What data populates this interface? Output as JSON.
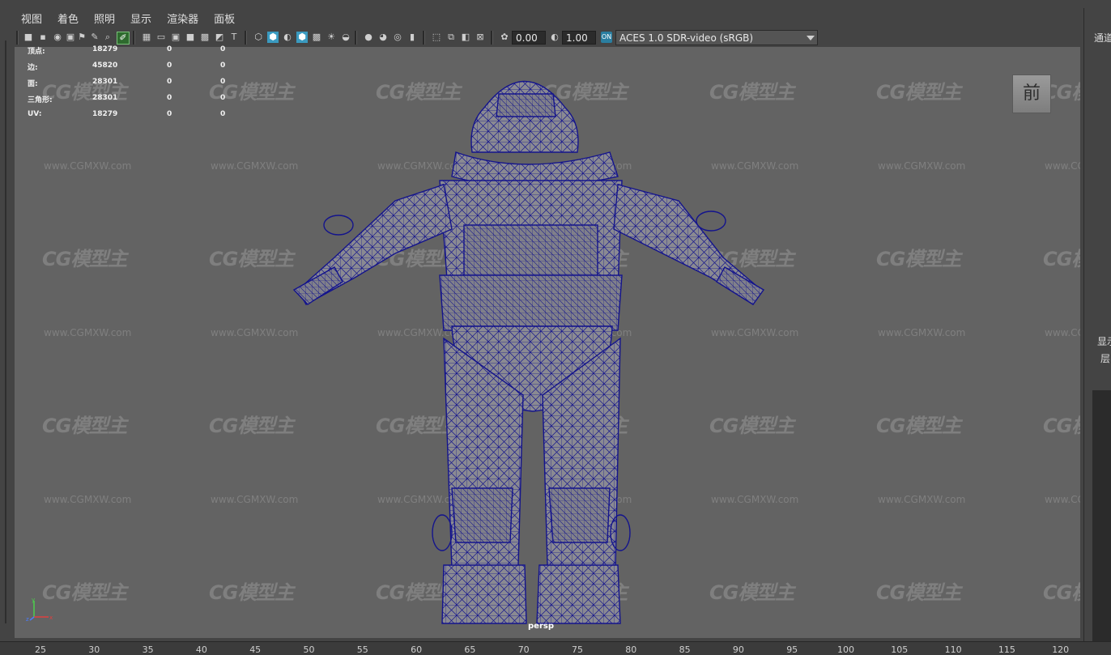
{
  "menu": {
    "items": [
      "视图",
      "着色",
      "照明",
      "显示",
      "渲染器",
      "面板"
    ]
  },
  "toolbar": {
    "exposure_value": "0.00",
    "gamma_value": "1.00",
    "color_space": "ACES 1.0 SDR-video (sRGB)"
  },
  "hud": {
    "rows": [
      {
        "label": "顶点:",
        "v1": "18279",
        "v2": "0",
        "v3": "0"
      },
      {
        "label": "边:",
        "v1": "45820",
        "v2": "0",
        "v3": "0"
      },
      {
        "label": "面:",
        "v1": "28301",
        "v2": "0",
        "v3": "0"
      },
      {
        "label": "三角形:",
        "v1": "28301",
        "v2": "0",
        "v3": "0"
      },
      {
        "label": "UV:",
        "v1": "18279",
        "v2": "0",
        "v3": "0"
      }
    ]
  },
  "viewport": {
    "camera": "persp",
    "view_cube_label": "前",
    "watermark_logo": "CG模型主",
    "watermark_url": "www.CGMXW.com",
    "axis_labels": {
      "y": "y",
      "x": "x",
      "z": "z"
    }
  },
  "right_panel": {
    "top_label": "通道",
    "display_label": "显示",
    "layer_label": "层"
  },
  "timeline": {
    "ticks": [
      "25",
      "30",
      "35",
      "40",
      "45",
      "50",
      "55",
      "60",
      "65",
      "70",
      "75",
      "80",
      "85",
      "90",
      "95",
      "100",
      "105",
      "110",
      "115",
      "120"
    ]
  },
  "colors": {
    "viewport_bg": "#636363",
    "wireframe": "#14148c",
    "ui_bg": "#444444",
    "highlight_button": "#3a9ac0"
  }
}
